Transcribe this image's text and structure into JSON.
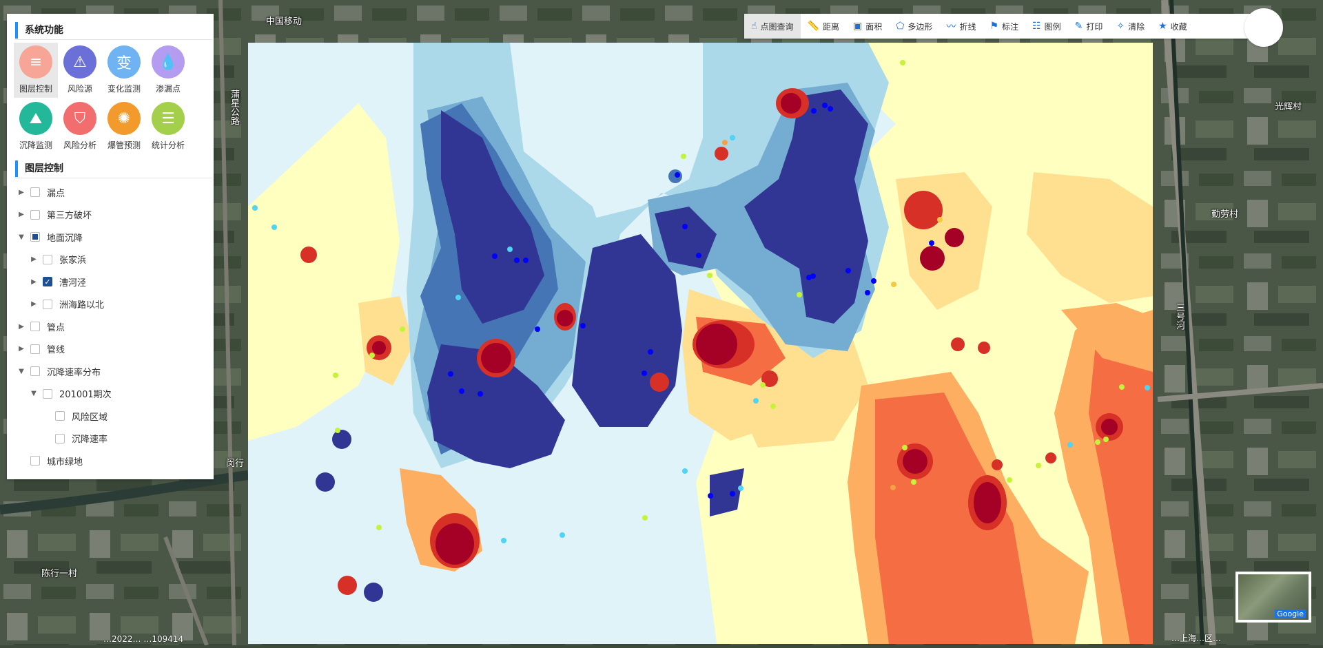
{
  "panel": {
    "functions_title": "系统功能",
    "functions": [
      {
        "label": "图层控制",
        "icon": "layers-icon",
        "color": "#f6a596",
        "glyph": "≡",
        "selected": true
      },
      {
        "label": "风险源",
        "icon": "alarm-light-icon",
        "color": "#6b6fd8",
        "glyph": "⚠",
        "selected": false
      },
      {
        "label": "变化监测",
        "icon": "change-icon",
        "color": "#6fb3f2",
        "glyph": "变",
        "selected": false
      },
      {
        "label": "渗漏点",
        "icon": "water-drop-icon",
        "color": "#b49cf0",
        "glyph": "💧",
        "selected": false
      },
      {
        "label": "沉降监测",
        "icon": "subsidence-icon",
        "color": "#24b89a",
        "glyph": "⛰",
        "selected": false
      },
      {
        "label": "风险分析",
        "icon": "shield-icon",
        "color": "#f26d6d",
        "glyph": "⛉",
        "selected": false
      },
      {
        "label": "爆管预测",
        "icon": "burst-pipe-icon",
        "color": "#f39a2d",
        "glyph": "✺",
        "selected": false
      },
      {
        "label": "统计分析",
        "icon": "report-icon",
        "color": "#a4cf4a",
        "glyph": "☰",
        "selected": false
      }
    ],
    "layers_title": "图层控制",
    "layers": [
      {
        "label": "漏点",
        "level": 0,
        "arrow": "right",
        "state": "unchecked"
      },
      {
        "label": "第三方破坏",
        "level": 0,
        "arrow": "right",
        "state": "unchecked"
      },
      {
        "label": "地面沉降",
        "level": 0,
        "arrow": "down",
        "state": "half"
      },
      {
        "label": "张家浜",
        "level": 1,
        "arrow": "right",
        "state": "unchecked"
      },
      {
        "label": "漕河泾",
        "level": 1,
        "arrow": "right",
        "state": "checked"
      },
      {
        "label": "洲海路以北",
        "level": 1,
        "arrow": "right",
        "state": "unchecked"
      },
      {
        "label": "管点",
        "level": 0,
        "arrow": "right",
        "state": "unchecked"
      },
      {
        "label": "管线",
        "level": 0,
        "arrow": "right",
        "state": "unchecked"
      },
      {
        "label": "沉降速率分布",
        "level": 0,
        "arrow": "down",
        "state": "unchecked"
      },
      {
        "label": "201001期次",
        "level": 1,
        "arrow": "down",
        "state": "unchecked"
      },
      {
        "label": "风险区域",
        "level": 2,
        "arrow": "none",
        "state": "unchecked"
      },
      {
        "label": "沉降速率",
        "level": 2,
        "arrow": "none",
        "state": "unchecked"
      },
      {
        "label": "城市绿地",
        "level": 0,
        "arrow": "none",
        "state": "unchecked"
      }
    ]
  },
  "toolbar": [
    {
      "label": "点图查询",
      "icon": "hand-pointer-icon",
      "glyph": "☝",
      "active": true
    },
    {
      "label": "距离",
      "icon": "ruler-icon",
      "glyph": "📏",
      "active": false
    },
    {
      "label": "面积",
      "icon": "area-icon",
      "glyph": "▣",
      "active": false
    },
    {
      "label": "多边形",
      "icon": "polygon-icon",
      "glyph": "⬠",
      "active": false
    },
    {
      "label": "折线",
      "icon": "polyline-icon",
      "glyph": "〰",
      "active": false
    },
    {
      "label": "标注",
      "icon": "flag-icon",
      "glyph": "⚑",
      "active": false
    },
    {
      "label": "图例",
      "icon": "legend-icon",
      "glyph": "☷",
      "active": false
    },
    {
      "label": "打印",
      "icon": "print-icon",
      "glyph": "✎",
      "active": false
    },
    {
      "label": "清除",
      "icon": "clear-icon",
      "glyph": "✧",
      "active": false
    },
    {
      "label": "收藏",
      "icon": "star-icon",
      "glyph": "★",
      "active": false
    }
  ],
  "thumbnail": {
    "label": "Google"
  },
  "status": {
    "left": "…2022…  …109414",
    "right": "…上海…区…"
  },
  "map_labels": {
    "l1": "中国移动",
    "l2": "蒲星公路",
    "l3": "陈行一村",
    "l4": "勤劳村",
    "l5": "光辉村",
    "l6": "三号河",
    "l7": "闵行"
  },
  "colors": {
    "accent": "#1e90ff",
    "contour_deep_blue": "#313695",
    "contour_blue": "#4575b4",
    "contour_light_blue": "#abd9e9",
    "contour_pale": "#e0f3f8",
    "contour_yellow": "#ffffbf",
    "contour_orange": "#fdae61",
    "contour_red_orange": "#f46d43",
    "contour_red": "#d73027",
    "contour_dark_red": "#a50026"
  }
}
